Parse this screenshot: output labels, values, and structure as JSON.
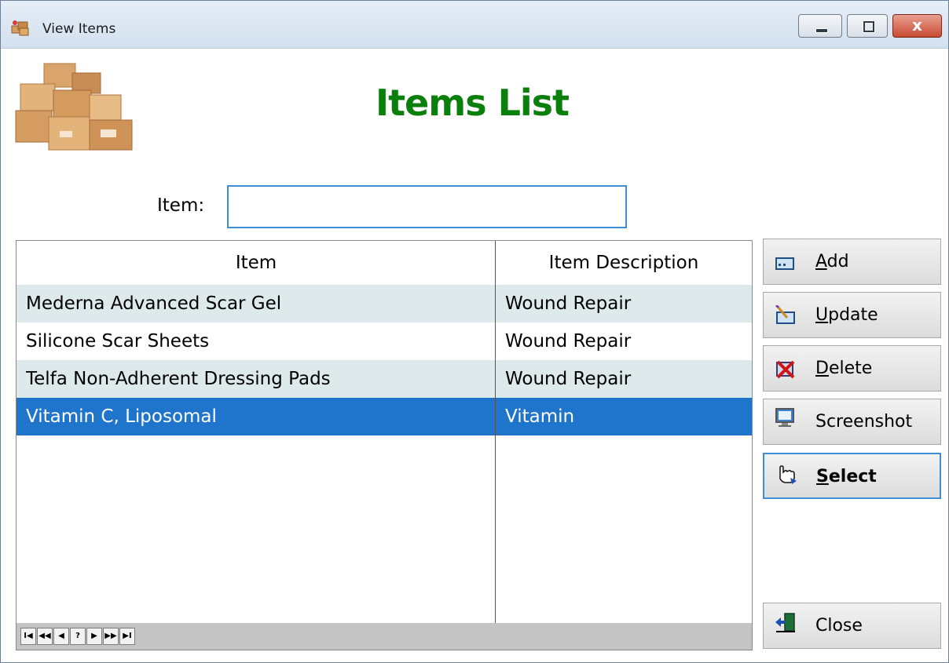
{
  "window": {
    "title": "View Items",
    "close_glyph": "x"
  },
  "header": {
    "title": "Items List"
  },
  "search": {
    "label": "Item:",
    "value": ""
  },
  "grid": {
    "columns": [
      "Item",
      "Item Description"
    ],
    "rows": [
      {
        "item": "Mederna Advanced Scar Gel",
        "description": "Wound Repair"
      },
      {
        "item": "Silicone Scar Sheets",
        "description": "Wound Repair"
      },
      {
        "item": "Telfa Non-Adherent Dressing Pads",
        "description": "Wound Repair"
      },
      {
        "item": "Vitamin C, Liposomal",
        "description": "Vitamin"
      }
    ],
    "selected_row": 3,
    "navigator": [
      "I◀",
      "◀◀",
      "◀",
      "?",
      "▶",
      "▶▶",
      "▶I"
    ]
  },
  "buttons": {
    "add": {
      "mnemonic": "A",
      "rest": "dd",
      "icon": "add-form-icon"
    },
    "update": {
      "mnemonic": "U",
      "rest": "pdate",
      "icon": "edit-pencil-icon"
    },
    "delete": {
      "mnemonic": "D",
      "rest": "elete",
      "icon": "delete-x-icon"
    },
    "screenshot": {
      "label": "Screenshot",
      "icon": "screenshot-icon"
    },
    "select": {
      "mnemonic": "S",
      "rest": "elect",
      "icon": "hand-pointer-icon"
    },
    "close": {
      "label": "Close",
      "icon": "exit-door-icon"
    }
  },
  "colors": {
    "title_green": "#0b7f0b",
    "selection_blue": "#1f74cc",
    "alt_row": "#dde9ea",
    "focus_border": "#3c8fd6"
  }
}
